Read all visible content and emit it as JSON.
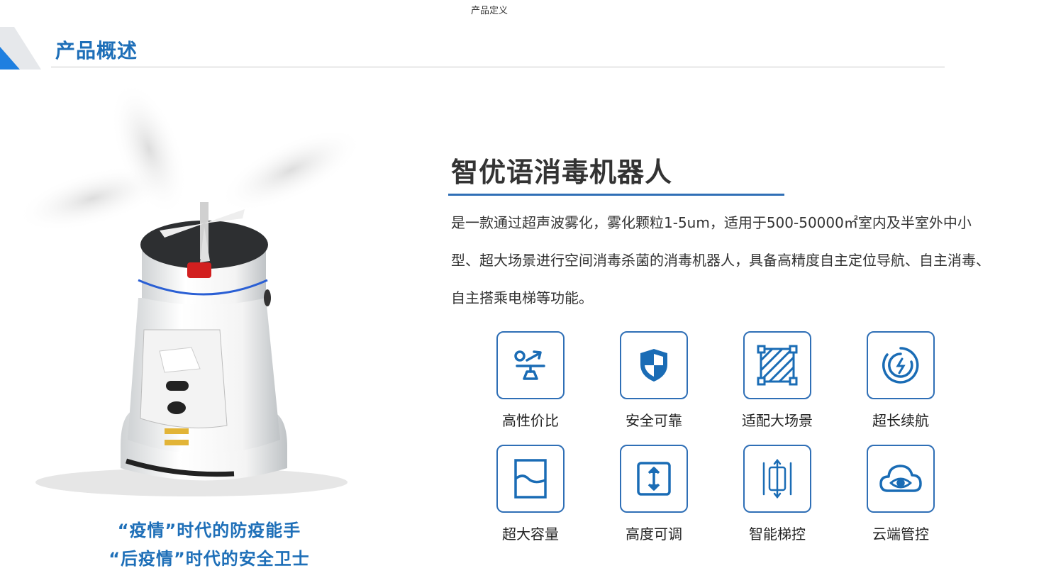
{
  "top_caption": "产品定义",
  "section": {
    "title": "产品概述"
  },
  "product": {
    "name": "智优语消毒机器人",
    "description": "是一款通过超声波雾化，雾化颗粒1-5um，适用于500-50000㎡室内及半室外中小型、超大场景进行空间消毒杀菌的消毒机器人，具备高精度自主定位导航、自主消毒、自主搭乘电梯等功能。"
  },
  "slogans": [
    "“疫情”时代的防疫能手",
    "“后疫情”时代的安全卫士"
  ],
  "features": [
    {
      "label": "高性价比",
      "icon": "scale-icon"
    },
    {
      "label": "安全可靠",
      "icon": "shield-icon"
    },
    {
      "label": "适配大场景",
      "icon": "area-icon"
    },
    {
      "label": "超长续航",
      "icon": "battery-cycle-icon"
    },
    {
      "label": "超大容量",
      "icon": "tank-icon"
    },
    {
      "label": "高度可调",
      "icon": "height-adjust-icon"
    },
    {
      "label": "智能梯控",
      "icon": "elevator-icon"
    },
    {
      "label": "云端管控",
      "icon": "cloud-eye-icon"
    }
  ],
  "colors": {
    "accent": "#1e6fb8",
    "icon_blue": "#1a6cb5",
    "rule": "#2f6fb6"
  }
}
